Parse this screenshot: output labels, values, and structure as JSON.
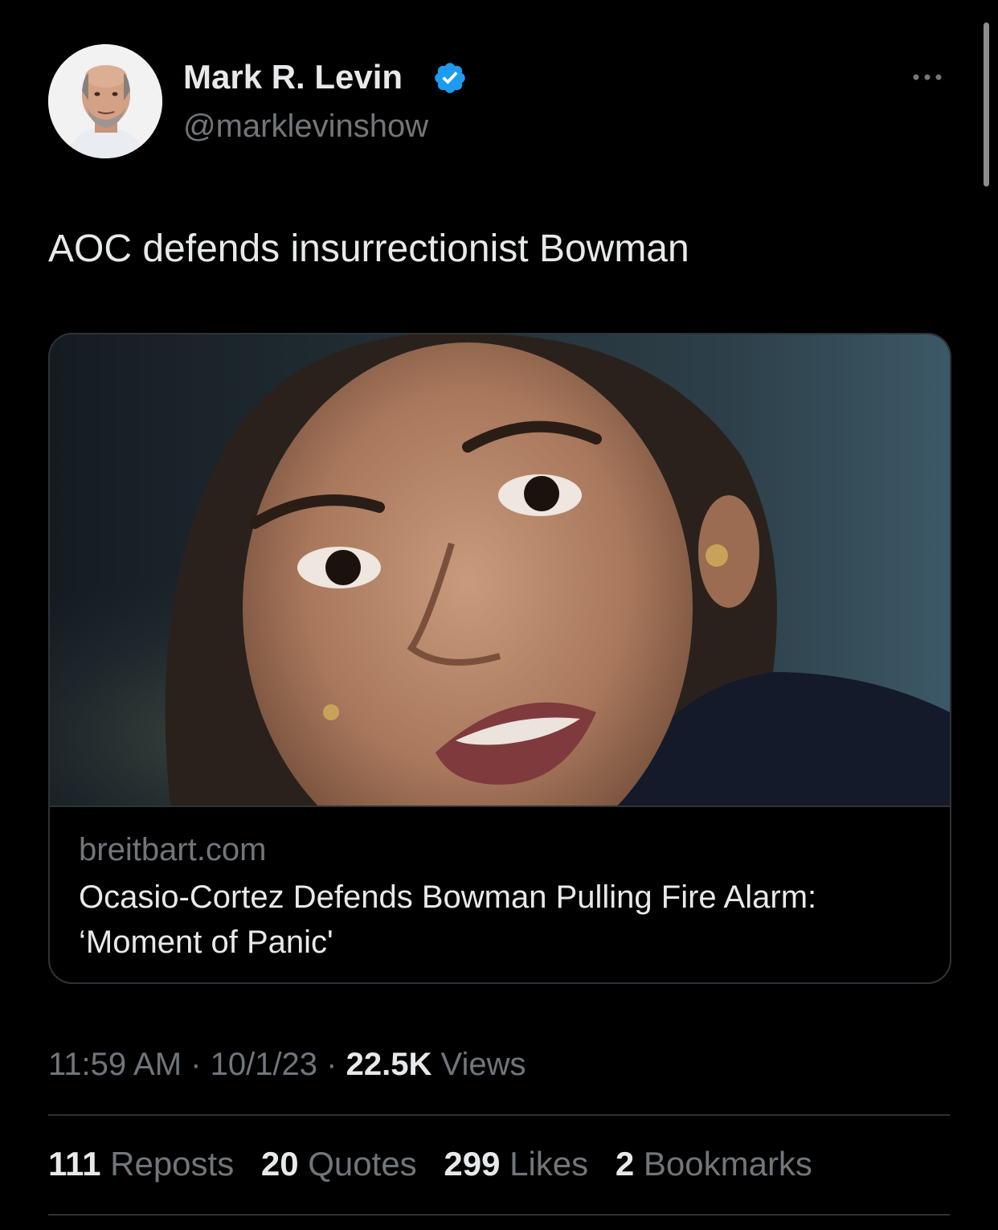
{
  "author": {
    "display_name": "Mark R. Levin",
    "handle": "@marklevinshow",
    "verified": true
  },
  "tweet": {
    "text": "AOC defends insurrectionist Bowman"
  },
  "link_card": {
    "domain": "breitbart.com",
    "title": "Ocasio-Cortez Defends Bowman Pulling Fire Alarm: ‘Moment of Panic'"
  },
  "meta": {
    "time": "11:59 AM",
    "separator": " · ",
    "date": "10/1/23",
    "views_count": "22.5K",
    "views_label": "Views"
  },
  "stats": {
    "reposts_count": "111",
    "reposts_label": "Reposts",
    "quotes_count": "20",
    "quotes_label": "Quotes",
    "likes_count": "299",
    "likes_label": "Likes",
    "bookmarks_count": "2",
    "bookmarks_label": "Bookmarks"
  },
  "colors": {
    "background": "#000000",
    "primary_text": "#e7e9ea",
    "secondary_text": "#71767b",
    "border": "#2f3336",
    "verified_blue": "#1d9bf0"
  },
  "icons": {
    "verified": "verified-badge-icon",
    "more": "more-dots-icon"
  }
}
